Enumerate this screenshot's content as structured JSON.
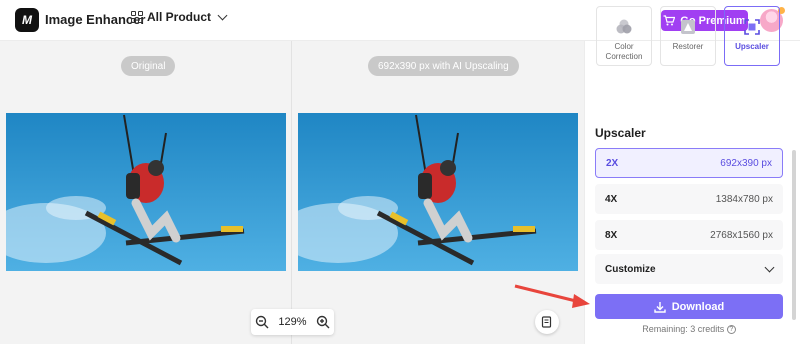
{
  "header": {
    "logo_text": "M",
    "app_title": "Image Enhancer",
    "all_product_label": "All Product",
    "premium_label": "Go Premium"
  },
  "canvas": {
    "original_label": "Original",
    "upscaled_label": "692x390 px with AI Upscaling",
    "zoom_level": "129%"
  },
  "panel": {
    "tools": [
      {
        "label": "Color\nCorrection",
        "icon": "color-correction-icon",
        "active": false
      },
      {
        "label": "Restorer",
        "icon": "restorer-icon",
        "active": false
      },
      {
        "label": "Upscaler",
        "icon": "upscaler-icon",
        "active": true
      }
    ],
    "section_title": "Upscaler",
    "options": [
      {
        "key": "2X",
        "value": "692x390 px",
        "active": true
      },
      {
        "key": "4X",
        "value": "1384x780 px",
        "active": false
      },
      {
        "key": "8X",
        "value": "2768x1560 px",
        "active": false
      },
      {
        "key": "Customize",
        "value": "",
        "active": false
      }
    ],
    "download_label": "Download",
    "remaining_text": "Remaining: 3 credits"
  },
  "colors": {
    "accent": "#7c6ff5",
    "premium": "#a13ff2",
    "annotation_arrow": "#e8453c"
  }
}
